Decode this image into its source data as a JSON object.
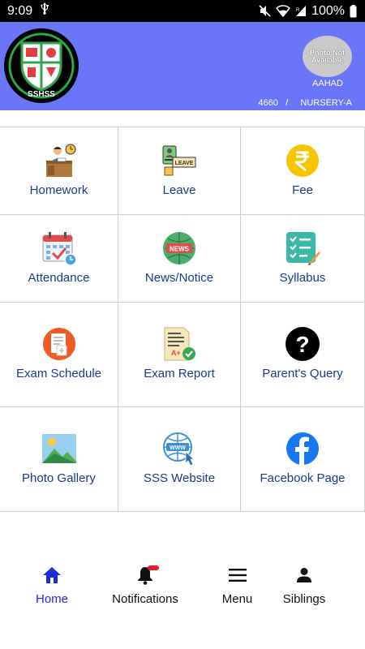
{
  "status_bar": {
    "time": "9:09",
    "battery": "100%",
    "icons": [
      "usb-icon",
      "mute-icon",
      "wifi-icon",
      "signal-icon",
      "battery-icon"
    ]
  },
  "header": {
    "logo_text": "SSHSS",
    "photo_placeholder": "Photo Not Available",
    "student_name": "AAHAD",
    "student_id": "4660",
    "separator": "/",
    "class_section": "NURSERY-A",
    "background_color": "#6a75f7"
  },
  "grid": {
    "items": [
      {
        "label": "Homework",
        "icon": "homework-icon"
      },
      {
        "label": "Leave",
        "icon": "leave-icon"
      },
      {
        "label": "Fee",
        "icon": "rupee-icon"
      },
      {
        "label": "Attendance",
        "icon": "calendar-icon"
      },
      {
        "label": "News/Notice",
        "icon": "news-icon"
      },
      {
        "label": "Syllabus",
        "icon": "syllabus-icon"
      },
      {
        "label": "Exam Schedule",
        "icon": "exam-schedule-icon"
      },
      {
        "label": "Exam Report",
        "icon": "exam-report-icon"
      },
      {
        "label": "Parent's Query",
        "icon": "question-icon"
      },
      {
        "label": "Photo Gallery",
        "icon": "gallery-icon"
      },
      {
        "label": "SSS Website",
        "icon": "website-icon"
      },
      {
        "label": "Facebook Page",
        "icon": "facebook-icon"
      }
    ],
    "label_color": "#1a3a8a"
  },
  "bottom_nav": {
    "items": [
      {
        "label": "Home",
        "icon": "home-icon",
        "active": true
      },
      {
        "label": "Notifications",
        "icon": "bell-icon",
        "active": false
      },
      {
        "label": "Menu",
        "icon": "menu-icon",
        "active": false
      },
      {
        "label": "Siblings",
        "icon": "person-icon",
        "active": false
      }
    ],
    "active_color": "#1e2bd6"
  }
}
